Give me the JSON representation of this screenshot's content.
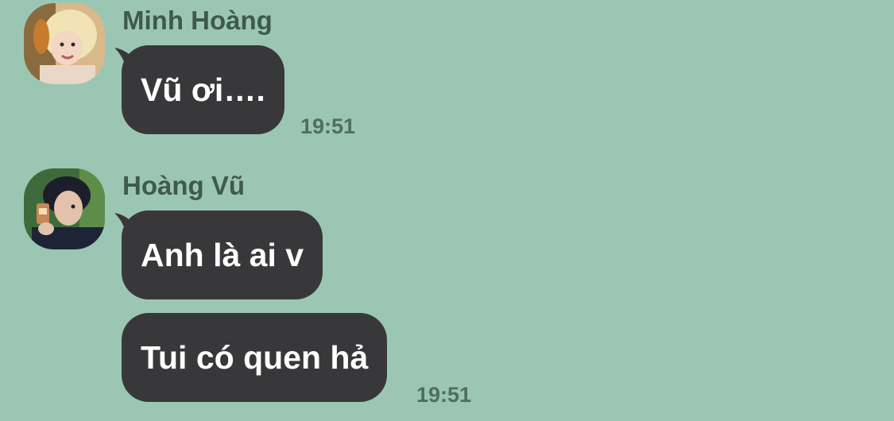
{
  "theme": {
    "background": "#9cc6b4",
    "bubble": "#38383a",
    "sender_name_color": "#3f5a4d",
    "timestamp_color": "#4e6e5f"
  },
  "messages": [
    {
      "sender": "Minh Hoàng",
      "avatar_icon": "avatar-minh-hoang",
      "bubbles": [
        "Vũ ơi…."
      ],
      "time": "19:51"
    },
    {
      "sender": "Hoàng Vũ",
      "avatar_icon": "avatar-hoang-vu",
      "bubbles": [
        "Anh là ai v",
        "Tui có quen hả"
      ],
      "time": "19:51"
    }
  ]
}
